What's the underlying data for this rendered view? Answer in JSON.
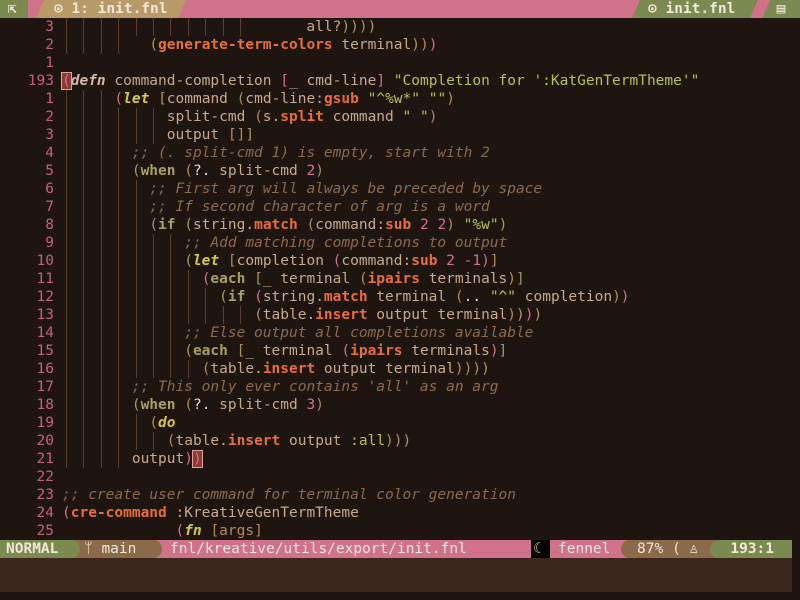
{
  "tabline": {
    "left_icon": "collapse-arrow-icon",
    "tab_label": "1: init.fnl",
    "tab_icon": "circle-dot-icon",
    "right_file": "init.fnl",
    "right_icon": "file-icon",
    "colors": {
      "bar": "#d0728a",
      "tab": "#b89a68",
      "accent": "#7a8a50"
    }
  },
  "lines": [
    {
      "n": "3",
      "t": [
        [
          "p",
          "                            all?"
        ],
        [
          "b3",
          "))"
        ],
        [
          "b1",
          ")"
        ],
        [
          "b3",
          ")"
        ]
      ]
    },
    {
      "n": "2",
      "t": [
        [
          "p",
          "          "
        ],
        [
          "b3",
          "("
        ],
        [
          "f",
          "generate-term-colors"
        ],
        [
          "p",
          " terminal"
        ],
        [
          "b3",
          ")"
        ],
        [
          "b1",
          ")"
        ],
        [
          "b2",
          ")"
        ]
      ]
    },
    {
      "n": "1",
      "t": []
    },
    {
      "n": "193",
      "t": [
        [
          "cur",
          "("
        ],
        [
          "kd",
          "defn"
        ],
        [
          "p",
          " command-completion "
        ],
        [
          "b2",
          "["
        ],
        [
          "p",
          "_ cmd-line"
        ],
        [
          "b2",
          "]"
        ],
        [
          "p",
          " "
        ],
        [
          "s",
          "\"Completion for ':KatGenTermTheme'\""
        ]
      ]
    },
    {
      "n": "1",
      "t": [
        [
          "p",
          "      "
        ],
        [
          "b2",
          "("
        ],
        [
          "ki",
          "let"
        ],
        [
          "p",
          " "
        ],
        [
          "b3",
          "["
        ],
        [
          "p",
          "command "
        ],
        [
          "b1",
          "("
        ],
        [
          "p",
          "cmd-line:"
        ],
        [
          "f",
          "gsub"
        ],
        [
          "p",
          " "
        ],
        [
          "s",
          "\"^%w*\""
        ],
        [
          "p",
          " "
        ],
        [
          "s",
          "\"\""
        ],
        [
          "b1",
          ")"
        ]
      ]
    },
    {
      "n": "2",
      "t": [
        [
          "p",
          "            split-cmd "
        ],
        [
          "b1",
          "("
        ],
        [
          "p",
          "s."
        ],
        [
          "f",
          "split"
        ],
        [
          "p",
          " command "
        ],
        [
          "s",
          "\" \""
        ],
        [
          "b1",
          ")"
        ]
      ]
    },
    {
      "n": "3",
      "t": [
        [
          "p",
          "            output "
        ],
        [
          "b1",
          "[]"
        ],
        [
          "b3",
          "]"
        ]
      ]
    },
    {
      "n": "4",
      "t": [
        [
          "p",
          "        "
        ],
        [
          "c",
          ";; (. split-cmd 1) is empty, start with 2"
        ]
      ]
    },
    {
      "n": "5",
      "t": [
        [
          "p",
          "        "
        ],
        [
          "b3",
          "("
        ],
        [
          "k",
          "when"
        ],
        [
          "p",
          " "
        ],
        [
          "b1",
          "("
        ],
        [
          "w",
          "?."
        ],
        [
          "p",
          " split-cmd "
        ],
        [
          "n",
          "2"
        ],
        [
          "b1",
          ")"
        ]
      ]
    },
    {
      "n": "6",
      "t": [
        [
          "p",
          "          "
        ],
        [
          "c",
          ";; First arg will always be preceded by space"
        ]
      ]
    },
    {
      "n": "7",
      "t": [
        [
          "p",
          "          "
        ],
        [
          "c",
          ";; If second character of arg is a word"
        ]
      ]
    },
    {
      "n": "8",
      "t": [
        [
          "p",
          "          "
        ],
        [
          "b1",
          "("
        ],
        [
          "k",
          "if"
        ],
        [
          "p",
          " "
        ],
        [
          "b3",
          "("
        ],
        [
          "p",
          "string."
        ],
        [
          "f",
          "match"
        ],
        [
          "p",
          " "
        ],
        [
          "b1",
          "("
        ],
        [
          "p",
          "command:"
        ],
        [
          "f",
          "sub"
        ],
        [
          "p",
          " "
        ],
        [
          "n",
          "2 2"
        ],
        [
          "b1",
          ")"
        ],
        [
          "p",
          " "
        ],
        [
          "s",
          "\"%w\""
        ],
        [
          "b3",
          ")"
        ]
      ]
    },
    {
      "n": "9",
      "t": [
        [
          "p",
          "              "
        ],
        [
          "c",
          ";; Add matching completions to output"
        ]
      ]
    },
    {
      "n": "10",
      "t": [
        [
          "p",
          "              "
        ],
        [
          "b3",
          "("
        ],
        [
          "ki",
          "let"
        ],
        [
          "p",
          " "
        ],
        [
          "b1",
          "["
        ],
        [
          "p",
          "completion "
        ],
        [
          "b2",
          "("
        ],
        [
          "p",
          "command:"
        ],
        [
          "f",
          "sub"
        ],
        [
          "p",
          " "
        ],
        [
          "n",
          "2 -1"
        ],
        [
          "b2",
          ")"
        ],
        [
          "b1",
          "]"
        ]
      ]
    },
    {
      "n": "11",
      "t": [
        [
          "p",
          "                "
        ],
        [
          "b2",
          "("
        ],
        [
          "k",
          "each"
        ],
        [
          "p",
          " "
        ],
        [
          "b3",
          "["
        ],
        [
          "p",
          "_ terminal "
        ],
        [
          "b1",
          "("
        ],
        [
          "f",
          "ipairs"
        ],
        [
          "p",
          " terminals"
        ],
        [
          "b1",
          ")"
        ],
        [
          "b3",
          "]"
        ]
      ]
    },
    {
      "n": "12",
      "t": [
        [
          "p",
          "                  "
        ],
        [
          "b3",
          "("
        ],
        [
          "k",
          "if"
        ],
        [
          "p",
          " "
        ],
        [
          "b2",
          "("
        ],
        [
          "p",
          "string."
        ],
        [
          "f",
          "match"
        ],
        [
          "p",
          " terminal "
        ],
        [
          "b1",
          "("
        ],
        [
          "w",
          ".."
        ],
        [
          "p",
          " "
        ],
        [
          "s",
          "\"^\""
        ],
        [
          "p",
          " completion"
        ],
        [
          "b1",
          ")"
        ],
        [
          "b2",
          ")"
        ]
      ]
    },
    {
      "n": "13",
      "t": [
        [
          "p",
          "                      "
        ],
        [
          "b1",
          "("
        ],
        [
          "p",
          "table."
        ],
        [
          "f",
          "insert"
        ],
        [
          "p",
          " output terminal"
        ],
        [
          "b1",
          ")"
        ],
        [
          "b3",
          ")"
        ],
        [
          "b2",
          ")"
        ],
        [
          "b3",
          ")"
        ]
      ]
    },
    {
      "n": "14",
      "t": [
        [
          "p",
          "              "
        ],
        [
          "c",
          ";; Else output all completions available"
        ]
      ]
    },
    {
      "n": "15",
      "t": [
        [
          "p",
          "              "
        ],
        [
          "b3",
          "("
        ],
        [
          "k",
          "each"
        ],
        [
          "p",
          " "
        ],
        [
          "b1",
          "["
        ],
        [
          "p",
          "_ terminal "
        ],
        [
          "b2",
          "("
        ],
        [
          "f",
          "ipairs"
        ],
        [
          "p",
          " terminals"
        ],
        [
          "b2",
          ")"
        ],
        [
          "b1",
          "]"
        ]
      ]
    },
    {
      "n": "16",
      "t": [
        [
          "p",
          "                "
        ],
        [
          "b1",
          "("
        ],
        [
          "p",
          "table."
        ],
        [
          "f",
          "insert"
        ],
        [
          "p",
          " output terminal"
        ],
        [
          "b1",
          "))"
        ],
        [
          "b3",
          "))"
        ]
      ]
    },
    {
      "n": "17",
      "t": [
        [
          "p",
          "        "
        ],
        [
          "c",
          ";; This only ever contains 'all' as an arg"
        ]
      ]
    },
    {
      "n": "18",
      "t": [
        [
          "p",
          "        "
        ],
        [
          "b3",
          "("
        ],
        [
          "k",
          "when"
        ],
        [
          "p",
          " "
        ],
        [
          "b1",
          "("
        ],
        [
          "w",
          "?."
        ],
        [
          "p",
          " split-cmd "
        ],
        [
          "n",
          "3"
        ],
        [
          "b1",
          ")"
        ]
      ]
    },
    {
      "n": "19",
      "t": [
        [
          "p",
          "          "
        ],
        [
          "b1",
          "("
        ],
        [
          "ki",
          "do"
        ]
      ]
    },
    {
      "n": "20",
      "t": [
        [
          "p",
          "            "
        ],
        [
          "b1",
          "("
        ],
        [
          "p",
          "table."
        ],
        [
          "f",
          "insert"
        ],
        [
          "p",
          " output "
        ],
        [
          "s",
          ":all"
        ],
        [
          "b1",
          ")"
        ],
        [
          "b1",
          ")"
        ],
        [
          "b3",
          ")"
        ]
      ]
    },
    {
      "n": "21",
      "t": [
        [
          "p",
          "        output"
        ],
        [
          "b2",
          ")"
        ],
        [
          "cur",
          ")"
        ]
      ]
    },
    {
      "n": "22",
      "t": []
    },
    {
      "n": "23",
      "t": [
        [
          "c",
          ";; create user command for terminal color generation"
        ]
      ]
    },
    {
      "n": "24",
      "t": [
        [
          "b2",
          "("
        ],
        [
          "f",
          "cre-command"
        ],
        [
          "p",
          " :KreativeGenTermTheme"
        ]
      ]
    },
    {
      "n": "25",
      "t": [
        [
          "p",
          "             "
        ],
        [
          "b2",
          "("
        ],
        [
          "ki",
          "fn"
        ],
        [
          "p",
          " "
        ],
        [
          "b1",
          "[args]"
        ]
      ]
    }
  ],
  "status": {
    "mode": "NORMAL",
    "branch_icon": "git-branch-icon",
    "branch": "main",
    "path": "fnl/kreative/utils/export/init.fnl",
    "filetype_icon": "moon-icon",
    "filetype": "fennel",
    "percent": "87%",
    "scroll_icon": "paren-icon",
    "os_icon": "penguin-icon",
    "position": "193:1"
  }
}
